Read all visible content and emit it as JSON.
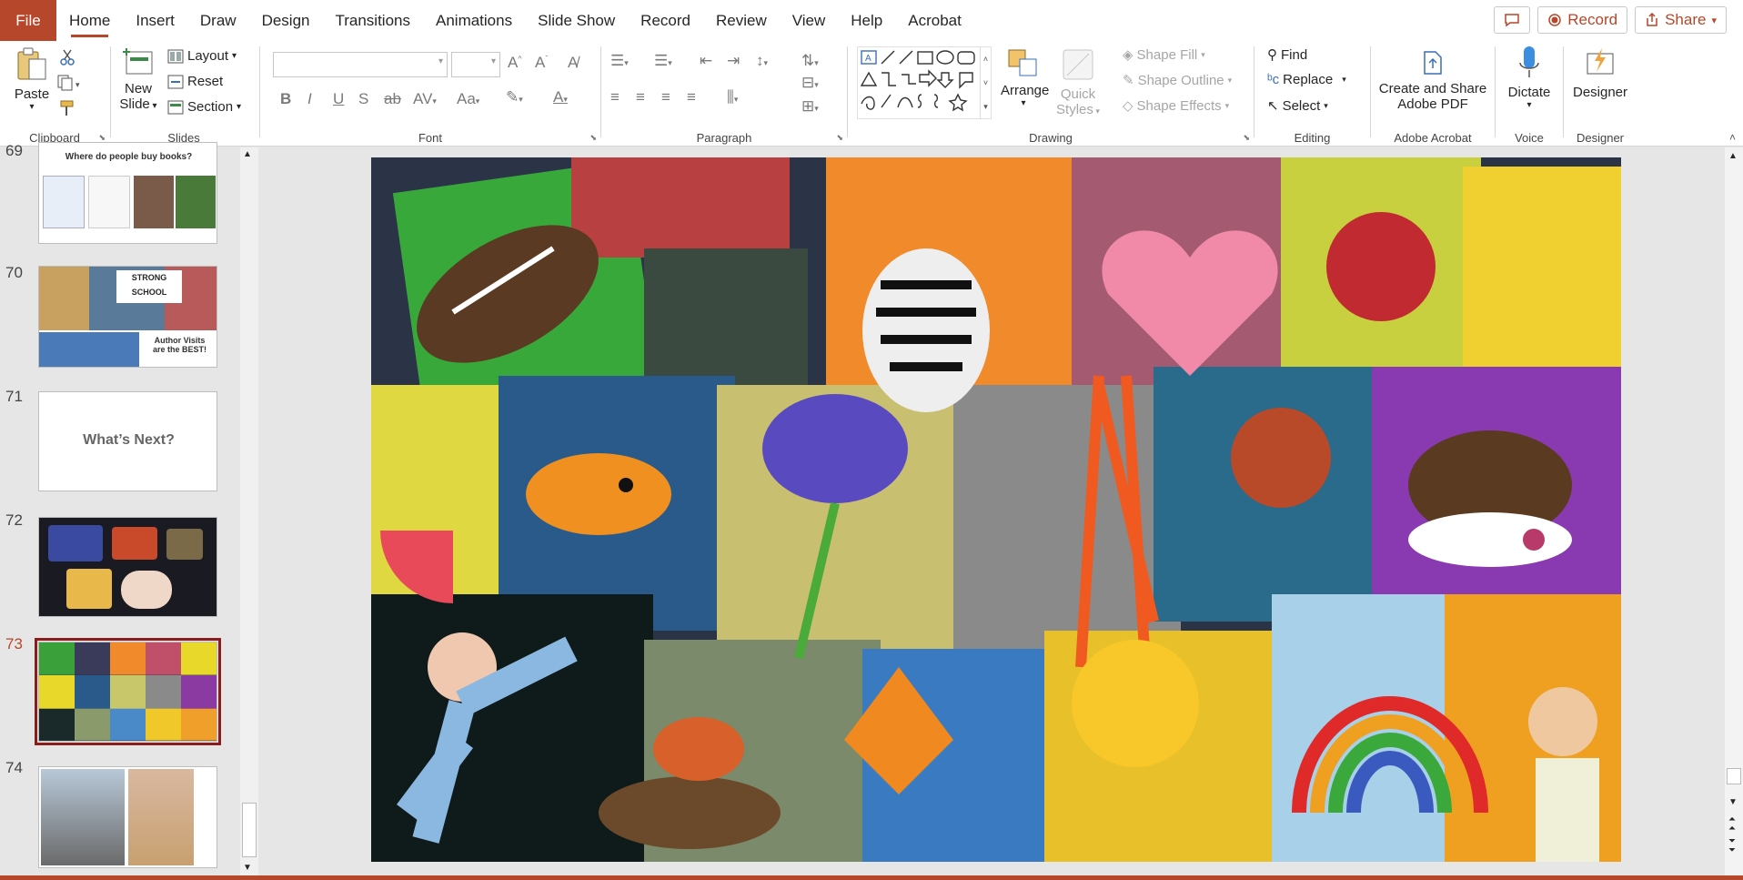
{
  "menu": {
    "file": "File",
    "tabs": [
      "Home",
      "Insert",
      "Draw",
      "Design",
      "Transitions",
      "Animations",
      "Slide Show",
      "Record",
      "Review",
      "View",
      "Help",
      "Acrobat"
    ],
    "active_tab": "Home",
    "record_label": "Record",
    "share_label": "Share"
  },
  "ribbon": {
    "clipboard": {
      "paste": "Paste",
      "label": "Clipboard"
    },
    "slides": {
      "new_slide_1": "New",
      "new_slide_2": "Slide",
      "layout": "Layout",
      "reset": "Reset",
      "section": "Section",
      "label": "Slides"
    },
    "font": {
      "label": "Font"
    },
    "paragraph": {
      "label": "Paragraph"
    },
    "drawing": {
      "arrange": "Arrange",
      "quick_styles_1": "Quick",
      "quick_styles_2": "Styles",
      "shape_fill": "Shape Fill",
      "shape_outline": "Shape Outline",
      "shape_effects": "Shape Effects",
      "label": "Drawing"
    },
    "editing": {
      "find": "Find",
      "replace": "Replace",
      "select": "Select",
      "label": "Editing"
    },
    "acrobat": {
      "line1": "Create and Share",
      "line2": "Adobe PDF",
      "label": "Adobe Acrobat"
    },
    "voice": {
      "dictate": "Dictate",
      "label": "Voice"
    },
    "designer": {
      "designer": "Designer",
      "label": "Designer"
    }
  },
  "slides_panel": {
    "items": [
      {
        "num": "69",
        "title": "Where do people buy books?"
      },
      {
        "num": "70",
        "title_1": "Author Visits",
        "title_2": "are the BEST!",
        "sign_1": "STRONG",
        "sign_2": "SCHOOL"
      },
      {
        "num": "71",
        "title": "What’s Next?"
      },
      {
        "num": "72"
      },
      {
        "num": "73",
        "selected": true
      },
      {
        "num": "74"
      }
    ]
  },
  "colors": {
    "accent": "#b7472a",
    "selected_border": "#8b1c1c"
  }
}
